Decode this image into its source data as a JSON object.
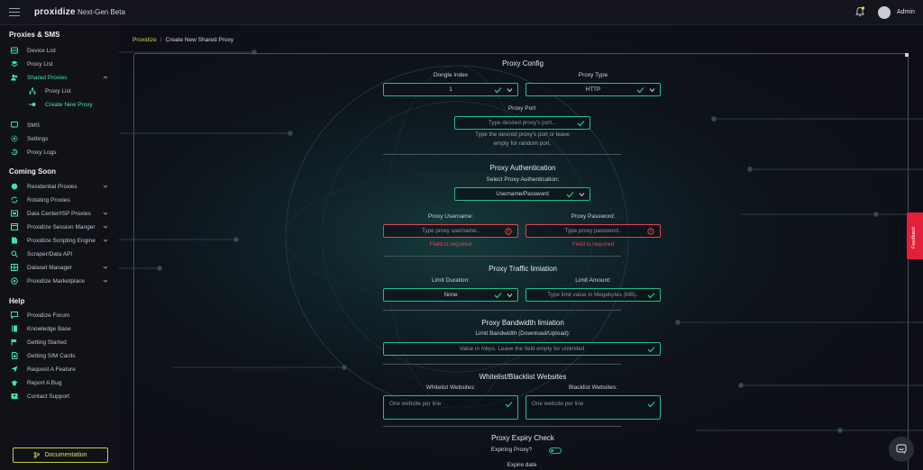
{
  "topbar": {
    "logo": "proxidize",
    "subtitle": "Next-Gen Beta",
    "user": "Admin"
  },
  "sidebar": {
    "section_proxies": "Proxies & SMS",
    "section_coming": "Coming Soon",
    "section_help": "Help",
    "items": [
      {
        "label": "Device List",
        "icon": "device-icon"
      },
      {
        "label": "Proxy List",
        "icon": "layers-icon"
      },
      {
        "label": "Shared Proxies",
        "icon": "users-icon"
      },
      {
        "label": "Proxy List",
        "icon": "tree-icon"
      },
      {
        "label": "Create New Proxy",
        "icon": "plus-key-icon"
      },
      {
        "label": "SMS",
        "icon": "chat-icon"
      },
      {
        "label": "Settings",
        "icon": "gear-icon"
      },
      {
        "label": "Proxy Logs",
        "icon": "history-icon"
      }
    ],
    "coming": [
      {
        "label": "Residential Proxies"
      },
      {
        "label": "Rotating Proxies"
      },
      {
        "label": "Data Center/ISP Proxies"
      },
      {
        "label": "Proxidize Session Manger"
      },
      {
        "label": "Proxidize Scripting Engine"
      },
      {
        "label": "Scraper/Data API"
      },
      {
        "label": "Dataset Manager"
      },
      {
        "label": "Proxidize Marketplace"
      }
    ],
    "help": [
      {
        "label": "Proxidize Forum"
      },
      {
        "label": "Knowledge Base"
      },
      {
        "label": "Getting Started"
      },
      {
        "label": "Getting SIM Cards"
      },
      {
        "label": "Request A Feature"
      },
      {
        "label": "Report A Bug"
      },
      {
        "label": "Contact Support"
      }
    ],
    "documentation": "Documentation"
  },
  "breadcrumb": {
    "root": "Proxidize",
    "separator": "/",
    "current": "Create New Shared Proxy"
  },
  "form": {
    "proxy_config": "Proxy Config",
    "dongle_index_label": "Dongle Index",
    "dongle_index_value": "1",
    "proxy_type_label": "Proxy Type",
    "proxy_type_value": "HTTP",
    "proxy_port_label": "Proxy Port",
    "proxy_port_placeholder": "Type desired proxy's port...",
    "proxy_port_hint_1": "Type the desired proxy's port or leave",
    "proxy_port_hint_2": "empty for random port.",
    "auth_title": "Proxy Authentication",
    "auth_select_label": "Select Proxy Authentication:",
    "auth_select_value": "Username/Password",
    "username_label": "Proxy Username:",
    "username_placeholder": "Type proxy username..",
    "password_label": "Proxy Password:",
    "password_placeholder": "Type proxy password..",
    "required_error": "Field is required",
    "traffic_title": "Proxy Traffic limiation",
    "limit_duration_label": "Limit Duration:",
    "limit_duration_value": "None",
    "limit_amount_label": "Limit Amount:",
    "limit_amount_placeholder": "Type limit value in Megabytes (MB)..",
    "bandwidth_title": "Proxy Bandwidth limiation",
    "bandwidth_label": "Limit Bandwidth (Download/Upload):",
    "bandwidth_placeholder": "Value in mbps. Leave the field empty for unlimited",
    "lists_title": "Whitelist/Blacklist Websites",
    "whitelist_label": "Whitelist Websites:",
    "whitelist_placeholder": "One website per line",
    "blacklist_label": "Blacklist Websites:",
    "blacklist_placeholder": "One website per line",
    "expiry_title": "Proxy Expiry Check",
    "expiring_label": "Expiring Proxy?",
    "expire_date_label": "Expire date"
  },
  "feedback": "Feedback",
  "colors": {
    "accent_green": "#1fbf87",
    "active_green": "#3ee6a2",
    "brand_yellow": "#d2d84a",
    "error_red": "#e0444f",
    "feedback_red": "#e3203a"
  }
}
